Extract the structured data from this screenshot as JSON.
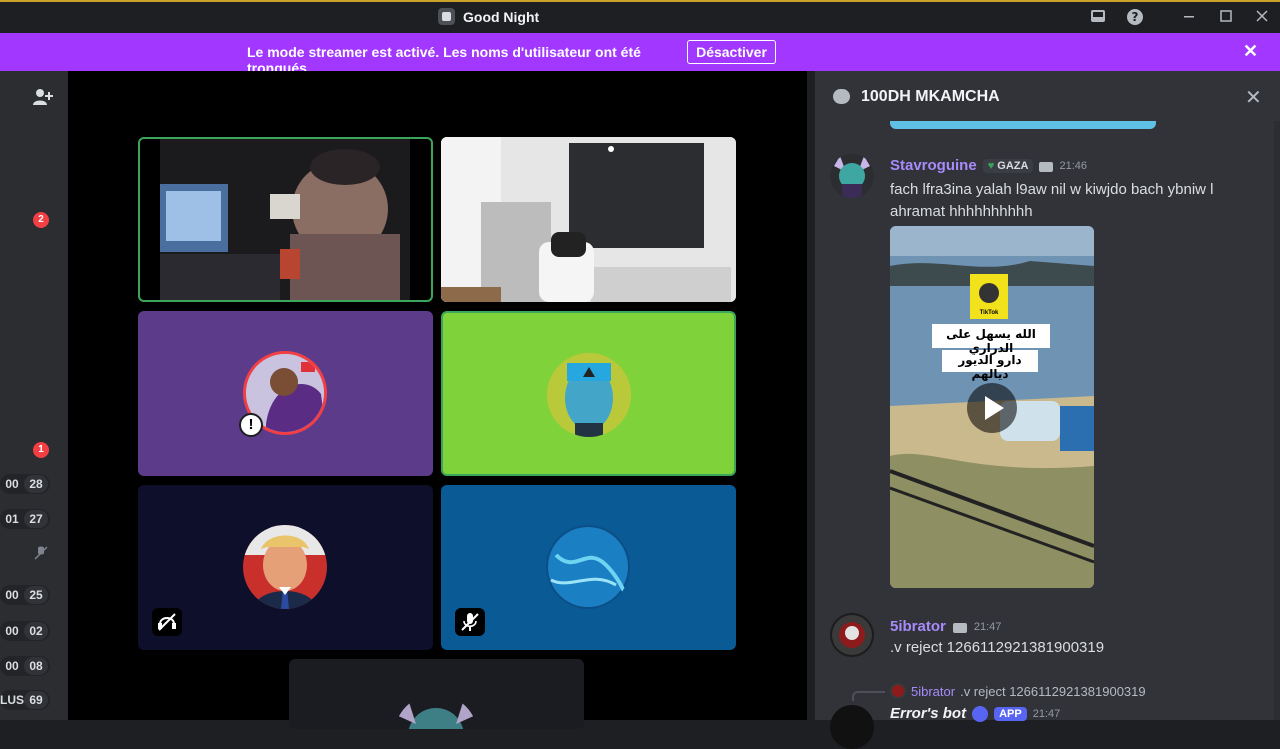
{
  "window": {
    "title": "Good Night",
    "controls": [
      "inbox-icon",
      "help-icon",
      "minimize-icon",
      "maximize-icon",
      "close-icon"
    ]
  },
  "banner": {
    "message": "Le mode streamer est activé. Les noms d'utilisateur ont été tronqués.",
    "button_label": "Désactiver",
    "close": "✕",
    "color": "#a238ff"
  },
  "sidebar": {
    "badges": [
      "2",
      "1"
    ],
    "timers": [
      {
        "a": "00",
        "b": "28"
      },
      {
        "a": "01",
        "b": "27"
      },
      {
        "a": "00",
        "b": "25"
      },
      {
        "a": "00",
        "b": "02"
      },
      {
        "a": "00",
        "b": "08"
      },
      {
        "a": "LUS",
        "b": "69"
      }
    ]
  },
  "stage": {
    "tiles": [
      {
        "kind": "video-webcam",
        "speaking": true
      },
      {
        "kind": "video-room",
        "speaking": false
      },
      {
        "kind": "avatar",
        "bg": "#5c3c8a",
        "speaking": false
      },
      {
        "kind": "avatar",
        "bg": "#7fd23a",
        "speaking": true
      },
      {
        "kind": "avatar",
        "bg": "#0d0f2b",
        "muted_icon": "deafened-icon"
      },
      {
        "kind": "avatar",
        "bg": "#0a5a96",
        "muted_icon": "mic-muted-icon"
      },
      {
        "kind": "avatar",
        "bg": "#1a1c22"
      }
    ]
  },
  "chat": {
    "channel_name": "100DH MKAMCHA",
    "messages": [
      {
        "author": "Stavroguine",
        "tag": "GAZA",
        "time": "21:46",
        "text": "fach lfra3ina yalah l9aw nil w kiwjdo bach ybniw l ahramat hhhhhhhhhh",
        "attachment_caption_line1": "الله يسهل على الدراري",
        "attachment_caption_line2": "دارو الديور ديالهم",
        "attachment_logo": "TikTok"
      },
      {
        "author": "5ibrator",
        "time": "21:47",
        "text": ".v reject 1266112921381900319"
      },
      {
        "reply_to_author": "5ibrator",
        "reply_to_text": ".v reject 1266112921381900319",
        "author": "Error's bot",
        "app_badge": "APP",
        "time": "21:47"
      }
    ]
  }
}
